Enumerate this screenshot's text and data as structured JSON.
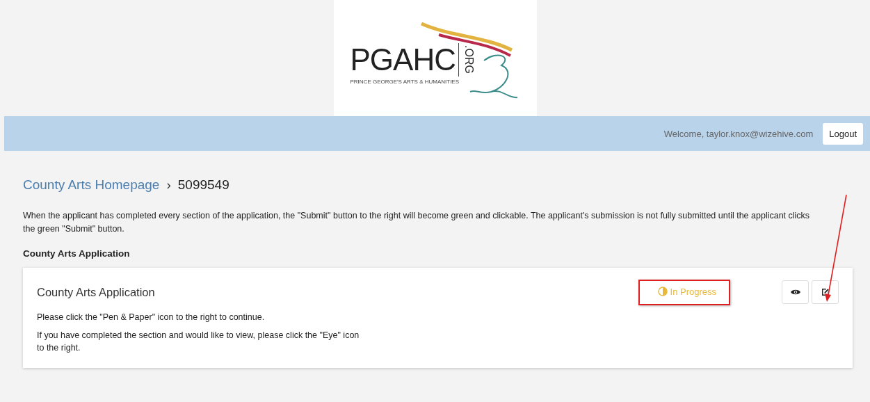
{
  "logo": {
    "name": "PGAHC",
    "suffix": ".ORG",
    "tagline": "PRINCE GEORGE'S ARTS & HUMANITIES"
  },
  "top_bar": {
    "welcome": "Welcome, taylor.knox@wizehive.com",
    "logout": "Logout"
  },
  "breadcrumb": {
    "link": "County Arts Homepage",
    "separator": "›",
    "current": "5099549"
  },
  "intro": "When the applicant has completed every section of the application, the \"Submit\" button to the right will become green and clickable. The applicant's submission is not fully submitted until the applicant clicks the green \"Submit\" button.",
  "section_heading": "County Arts Application",
  "card": {
    "title": "County Arts Application",
    "status": {
      "kind": "in_progress",
      "label": "In Progress",
      "highlighted": true
    },
    "lines": [
      "Please click the \"Pen & Paper\" icon to the right to continue.",
      "If you have completed the section and would like to view, please click the \"Eye\" icon to the right."
    ],
    "edit_arrow": true
  }
}
